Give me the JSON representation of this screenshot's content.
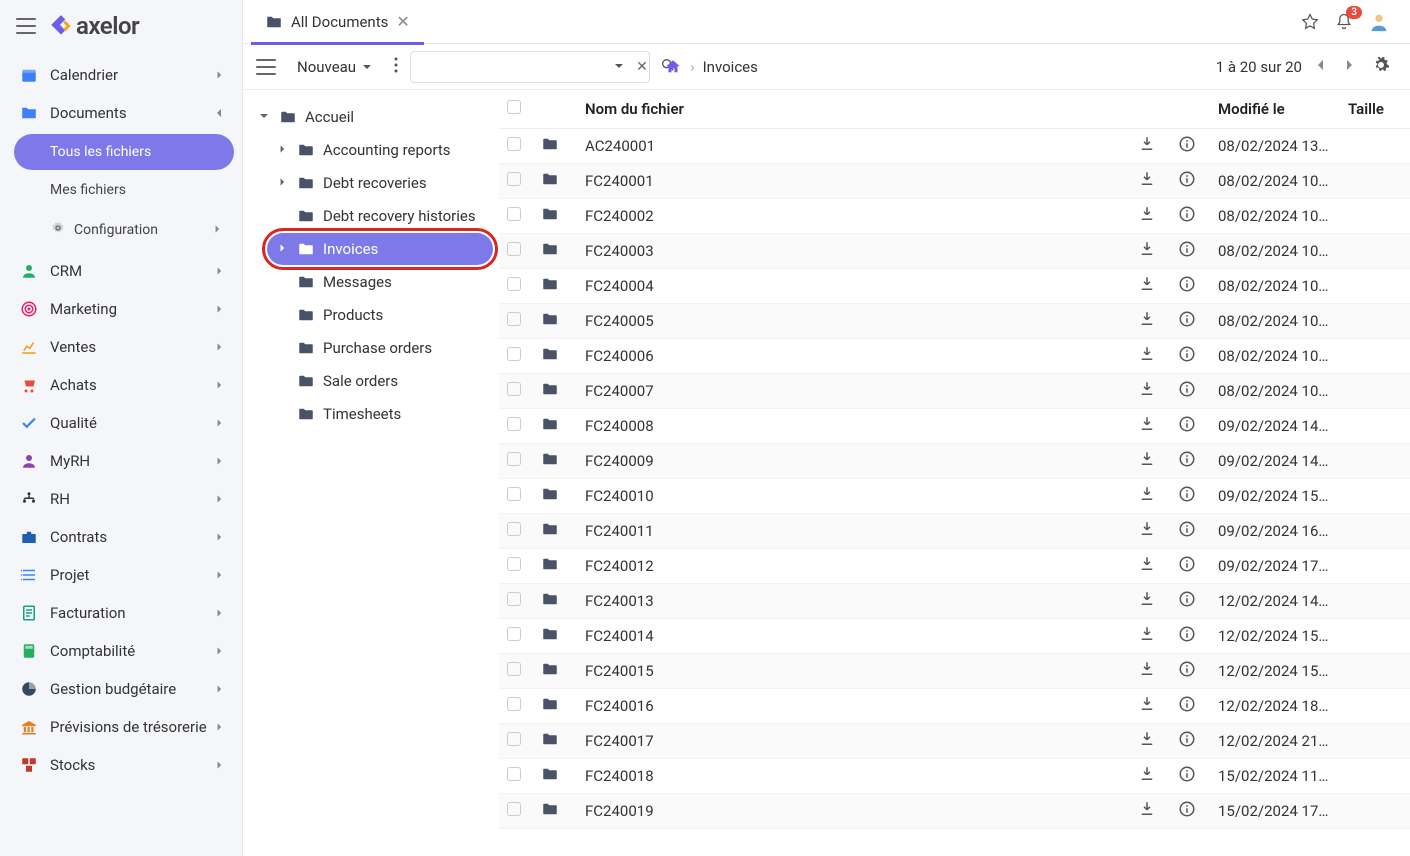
{
  "header": {
    "tab_label": "All Documents",
    "notification_count": "3"
  },
  "sidebar": {
    "items": [
      {
        "label": "Calendrier",
        "icon": "calendar",
        "color": "#3b82f6"
      },
      {
        "label": "Documents",
        "icon": "folder-tab",
        "color": "#3b82f6",
        "expanded": true,
        "children": [
          {
            "label": "Tous les fichiers",
            "active": true
          },
          {
            "label": "Mes fichiers"
          },
          {
            "label": "Configuration",
            "icon": "gear"
          }
        ]
      },
      {
        "label": "CRM",
        "icon": "user",
        "color": "#27ae60"
      },
      {
        "label": "Marketing",
        "icon": "target",
        "color": "#e91e63"
      },
      {
        "label": "Ventes",
        "icon": "chart",
        "color": "#f39c12"
      },
      {
        "label": "Achats",
        "icon": "cart",
        "color": "#e74c3c"
      },
      {
        "label": "Qualité",
        "icon": "check",
        "color": "#3b82f6"
      },
      {
        "label": "MyRH",
        "icon": "person",
        "color": "#8e44ad"
      },
      {
        "label": "RH",
        "icon": "org",
        "color": "#333"
      },
      {
        "label": "Contrats",
        "icon": "briefcase",
        "color": "#1f5fb0"
      },
      {
        "label": "Projet",
        "icon": "list",
        "color": "#3b82f6"
      },
      {
        "label": "Facturation",
        "icon": "receipt",
        "color": "#16a085"
      },
      {
        "label": "Comptabilité",
        "icon": "calculator",
        "color": "#27ae60"
      },
      {
        "label": "Gestion budgétaire",
        "icon": "pie",
        "color": "#34495e"
      },
      {
        "label": "Prévisions de trésorerie",
        "icon": "bank",
        "color": "#e67e22"
      },
      {
        "label": "Stocks",
        "icon": "boxes",
        "color": "#c0392b"
      }
    ]
  },
  "toolbar": {
    "new_label": "Nouveau",
    "search_placeholder": ""
  },
  "breadcrumb": {
    "current": "Invoices"
  },
  "paging": {
    "text": "1 à 20 sur 20"
  },
  "tree": {
    "root": "Accueil",
    "folders": [
      {
        "label": "Accounting reports",
        "arrow": true
      },
      {
        "label": "Debt recoveries",
        "arrow": true
      },
      {
        "label": "Debt recovery histories"
      },
      {
        "label": "Invoices",
        "arrow": true,
        "active": true,
        "highlighted": true
      },
      {
        "label": "Messages"
      },
      {
        "label": "Products"
      },
      {
        "label": "Purchase orders"
      },
      {
        "label": "Sale orders"
      },
      {
        "label": "Timesheets"
      }
    ]
  },
  "columns": {
    "name": "Nom du fichier",
    "modified": "Modifié le",
    "size": "Taille"
  },
  "files": [
    {
      "name": "AC240001",
      "modified": "08/02/2024 13:..."
    },
    {
      "name": "FC240001",
      "modified": "08/02/2024 10:..."
    },
    {
      "name": "FC240002",
      "modified": "08/02/2024 10:..."
    },
    {
      "name": "FC240003",
      "modified": "08/02/2024 10:..."
    },
    {
      "name": "FC240004",
      "modified": "08/02/2024 10:..."
    },
    {
      "name": "FC240005",
      "modified": "08/02/2024 10:..."
    },
    {
      "name": "FC240006",
      "modified": "08/02/2024 10:..."
    },
    {
      "name": "FC240007",
      "modified": "08/02/2024 10:..."
    },
    {
      "name": "FC240008",
      "modified": "09/02/2024 14:..."
    },
    {
      "name": "FC240009",
      "modified": "09/02/2024 14:..."
    },
    {
      "name": "FC240010",
      "modified": "09/02/2024 15:..."
    },
    {
      "name": "FC240011",
      "modified": "09/02/2024 16:..."
    },
    {
      "name": "FC240012",
      "modified": "09/02/2024 17:..."
    },
    {
      "name": "FC240013",
      "modified": "12/02/2024 14:..."
    },
    {
      "name": "FC240014",
      "modified": "12/02/2024 15:..."
    },
    {
      "name": "FC240015",
      "modified": "12/02/2024 15:..."
    },
    {
      "name": "FC240016",
      "modified": "12/02/2024 18:..."
    },
    {
      "name": "FC240017",
      "modified": "12/02/2024 21:..."
    },
    {
      "name": "FC240018",
      "modified": "15/02/2024 11:..."
    },
    {
      "name": "FC240019",
      "modified": "15/02/2024 17:..."
    }
  ]
}
